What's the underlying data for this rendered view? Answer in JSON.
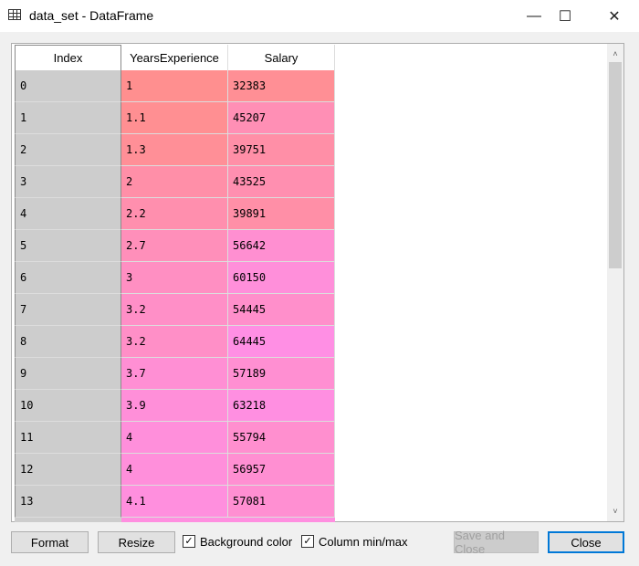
{
  "window": {
    "title": "data_set - DataFrame",
    "minimize": "—",
    "maximize": "☐",
    "close": "✕"
  },
  "table": {
    "columns": [
      "Index",
      "YearsExperience",
      "Salary"
    ],
    "rows": [
      [
        "0",
        "1",
        "32383"
      ],
      [
        "1",
        "1.1",
        "45207"
      ],
      [
        "2",
        "1.3",
        "39751"
      ],
      [
        "3",
        "2",
        "43525"
      ],
      [
        "4",
        "2.2",
        "39891"
      ],
      [
        "5",
        "2.7",
        "56642"
      ],
      [
        "6",
        "3",
        "60150"
      ],
      [
        "7",
        "3.2",
        "54445"
      ],
      [
        "8",
        "3.2",
        "64445"
      ],
      [
        "9",
        "3.7",
        "57189"
      ],
      [
        "10",
        "3.9",
        "63218"
      ],
      [
        "11",
        "4",
        "55794"
      ],
      [
        "12",
        "4",
        "56957"
      ],
      [
        "13",
        "4.1",
        "57081"
      ]
    ],
    "color_low": "#ff8f8f",
    "color_high": "#ff8fe8"
  },
  "scrollbar": {
    "up": "˄",
    "down": "˅"
  },
  "footer": {
    "format": "Format",
    "resize": "Resize",
    "background_color": "Background color",
    "background_color_checked": true,
    "column_minmax": "Column min/max",
    "column_minmax_checked": true,
    "save_and_close": "Save and Close",
    "close": "Close",
    "check": "✓"
  }
}
